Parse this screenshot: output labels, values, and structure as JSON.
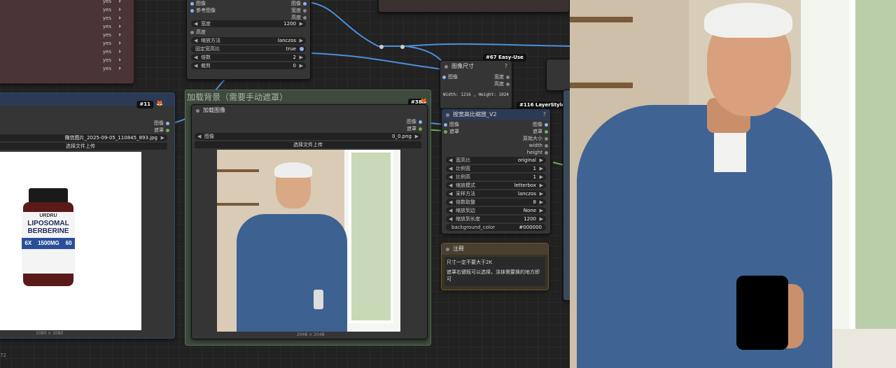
{
  "canvas": {
    "yes_rows": [
      "yes",
      "yes",
      "yes",
      "yes",
      "yes",
      "yes",
      "yes",
      "yes",
      "yes"
    ],
    "load_node_left": {
      "badge": "#11",
      "out_image": "图像",
      "out_mask": "遮罩",
      "filename": "微信图片_2025-09-05_110845_893.jpg",
      "upload_label": "选择文件上传",
      "size_label": "1080 × 1080"
    },
    "product": {
      "brand": "URDRU",
      "line1": "LIPOSOMAL",
      "line2": "BERBERINE",
      "strength": "6X",
      "dose": "1500MG",
      "count": "60"
    },
    "resize_node": {
      "in_image": "图像",
      "in_ref": "参考图像",
      "out_image": "图像",
      "out_width": "宽度",
      "out_height": "高度",
      "widgets": [
        {
          "label": "宽度",
          "value": "1200"
        },
        {
          "label": "高度",
          "value": ""
        },
        {
          "label": "缩放方法",
          "value": "lanczos"
        },
        {
          "label": "固定宽高比",
          "value": "true"
        },
        {
          "label": "倍数",
          "value": "2"
        },
        {
          "label": "裁剪",
          "value": "0"
        }
      ]
    },
    "group": {
      "title": "加载背景（需要手动遮罩）",
      "badge": "#38"
    },
    "load_bg": {
      "title": "加载图像",
      "out_image": "图像",
      "out_mask": "遮罩",
      "widget_label": "图像",
      "widget_value": "0_0.png",
      "upload_label": "选择文件上传",
      "size_label": "2048 × 2048"
    },
    "img_size": {
      "badge": "#67 Easy-Use",
      "title": "图像尺寸",
      "in_image": "图像",
      "out_width": "宽度",
      "out_height": "高度",
      "info": "Width: 1216 , Height: 1024"
    },
    "scale_node": {
      "badge": "#116 LayerStyle",
      "title": "按宽高比缩放_V2",
      "in_image": "图像",
      "in_mask": "遮罩",
      "out_image": "图像",
      "out_mask": "遮罩",
      "out_orig": "原始大小",
      "out_width": "width",
      "out_height": "height",
      "widgets": [
        {
          "label": "宽高比",
          "value": "original"
        },
        {
          "label": "比例宽",
          "value": "1"
        },
        {
          "label": "比例高",
          "value": "1"
        },
        {
          "label": "缩放模式",
          "value": "letterbox"
        },
        {
          "label": "采样方法",
          "value": "lanczos"
        },
        {
          "label": "倍数取整",
          "value": "8"
        },
        {
          "label": "缩放到边",
          "value": "None"
        },
        {
          "label": "缩放到长度",
          "value": "1200"
        },
        {
          "label": "background_color",
          "value": "#000000"
        }
      ]
    },
    "note": {
      "title": "注释",
      "line1": "尺寸一定不要大于2K",
      "line2": "遮罩右键既可以选择，涂抹需要换的地方即可"
    },
    "corner_text": "72"
  },
  "colors": {
    "link": "#4a90d9",
    "group_bg": "#3d4a3d",
    "node_bg": "#353535",
    "blue_title": "#2d3a55",
    "note_border": "#6b5530"
  }
}
